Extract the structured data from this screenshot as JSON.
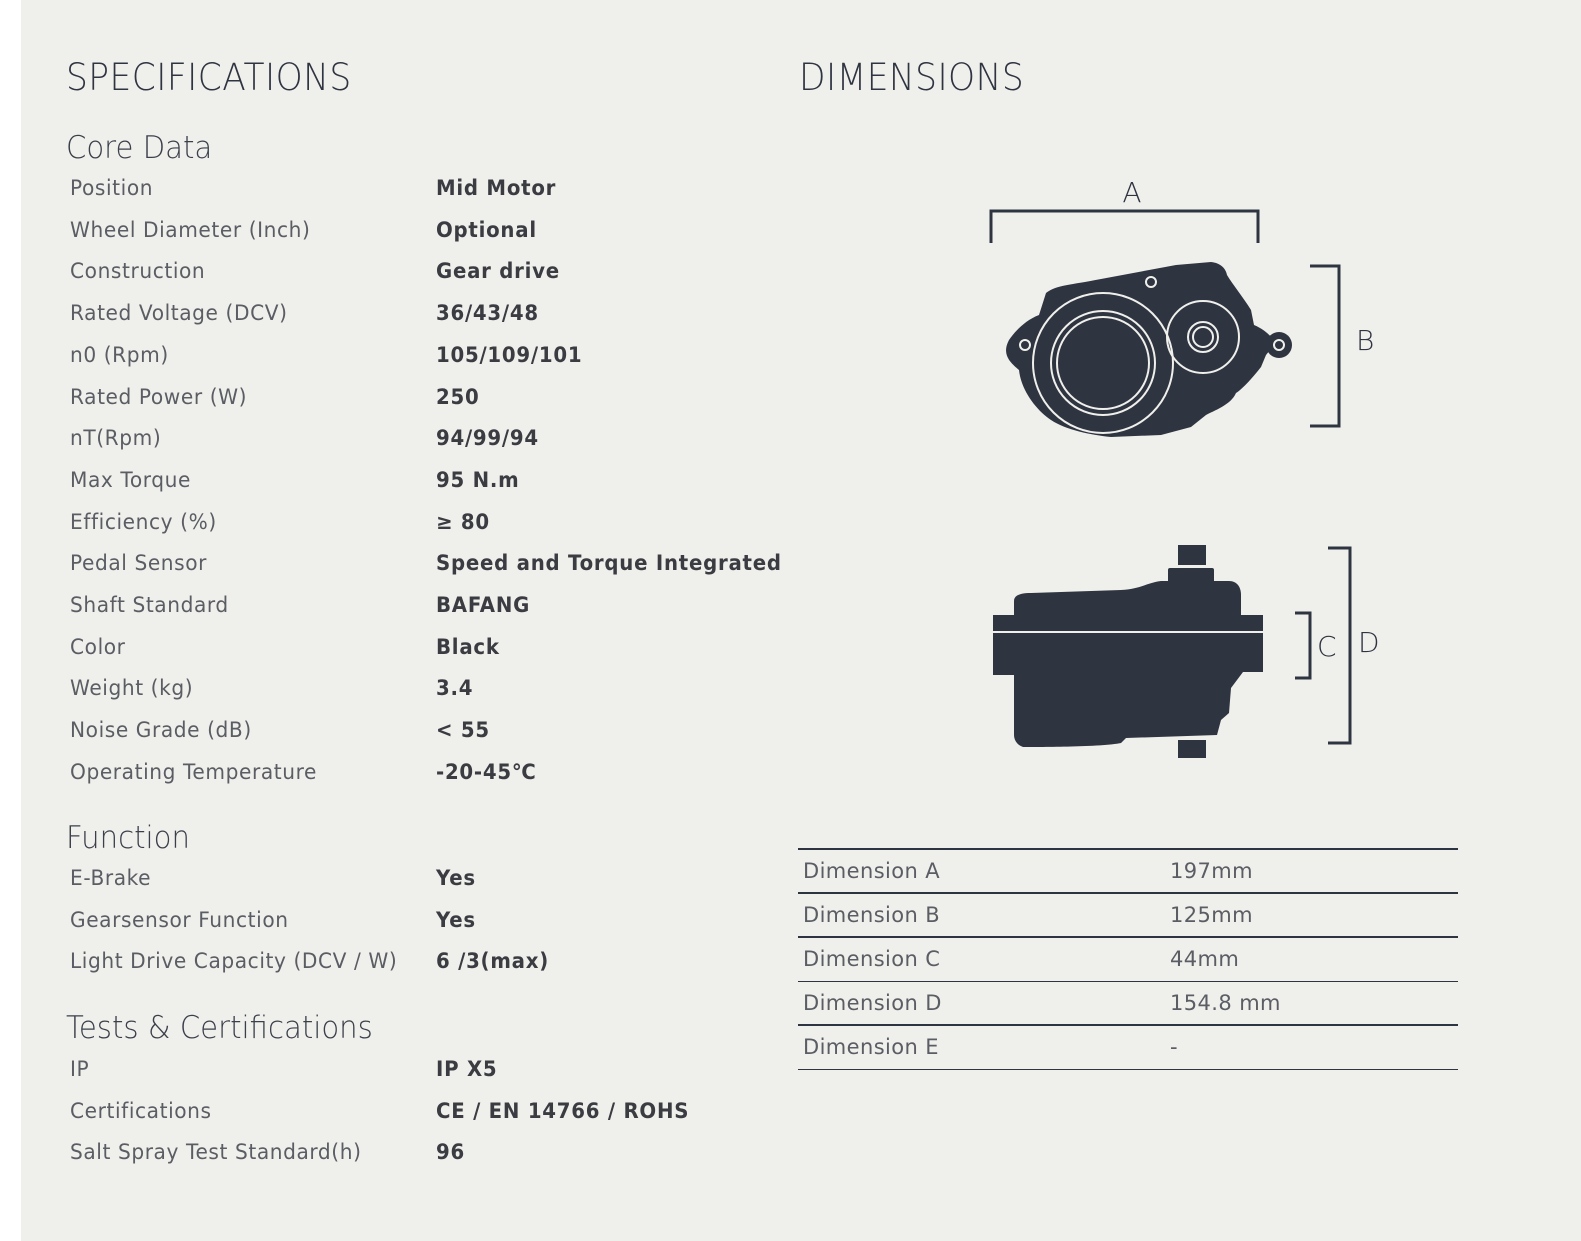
{
  "specifications": {
    "title": "SPECIFICATIONS",
    "sections": [
      {
        "title": "Core Data",
        "rows": [
          {
            "label": "Position",
            "value": "Mid Motor"
          },
          {
            "label": "Wheel Diameter (Inch)",
            "value": "Optional"
          },
          {
            "label": "Construction",
            "value": "Gear drive"
          },
          {
            "label": "Rated Voltage (DCV)",
            "value": "36/43/48"
          },
          {
            "label": "n0 (Rpm)",
            "value": "105/109/101"
          },
          {
            "label": "Rated Power (W)",
            "value": "250"
          },
          {
            "label": "nT(Rpm)",
            "value": "94/99/94"
          },
          {
            "label": "Max Torque",
            "value": "95 N.m"
          },
          {
            "label": "Efficiency (%)",
            "value": "≥ 80"
          },
          {
            "label": "Pedal Sensor",
            "value": "Speed and Torque Integrated"
          },
          {
            "label": "Shaft Standard",
            "value": "BAFANG"
          },
          {
            "label": "Color",
            "value": "Black"
          },
          {
            "label": "Weight (kg)",
            "value": "3.4"
          },
          {
            "label": "Noise Grade (dB)",
            "value": "< 55"
          },
          {
            "label": "Operating Temperature",
            "value": "-20-45℃"
          }
        ]
      },
      {
        "title": "Function",
        "rows": [
          {
            "label": "E-Brake",
            "value": "Yes"
          },
          {
            "label": "Gearsensor Function",
            "value": "Yes"
          },
          {
            "label": "Light Drive Capacity (DCV / W)",
            "value": "6 /3(max)"
          }
        ]
      },
      {
        "title": "Tests & Certifications",
        "rows": [
          {
            "label": "IP",
            "value": "IP X5"
          },
          {
            "label": "Certifications",
            "value": "CE / EN 14766 / ROHS"
          },
          {
            "label": "Salt Spray Test Standard(h)",
            "value": "96"
          }
        ]
      }
    ]
  },
  "dimensions": {
    "title": "DIMENSIONS",
    "diagram_labels": {
      "a": "A",
      "b": "B",
      "c": "C",
      "d": "D"
    },
    "motor_color": "#2f3441",
    "rows": [
      {
        "label": "Dimension A",
        "value": "197mm"
      },
      {
        "label": "Dimension B",
        "value": "125mm"
      },
      {
        "label": "Dimension C",
        "value": "44mm"
      },
      {
        "label": "Dimension D",
        "value": "154.8 mm"
      },
      {
        "label": "Dimension E",
        "value": "-"
      }
    ]
  }
}
